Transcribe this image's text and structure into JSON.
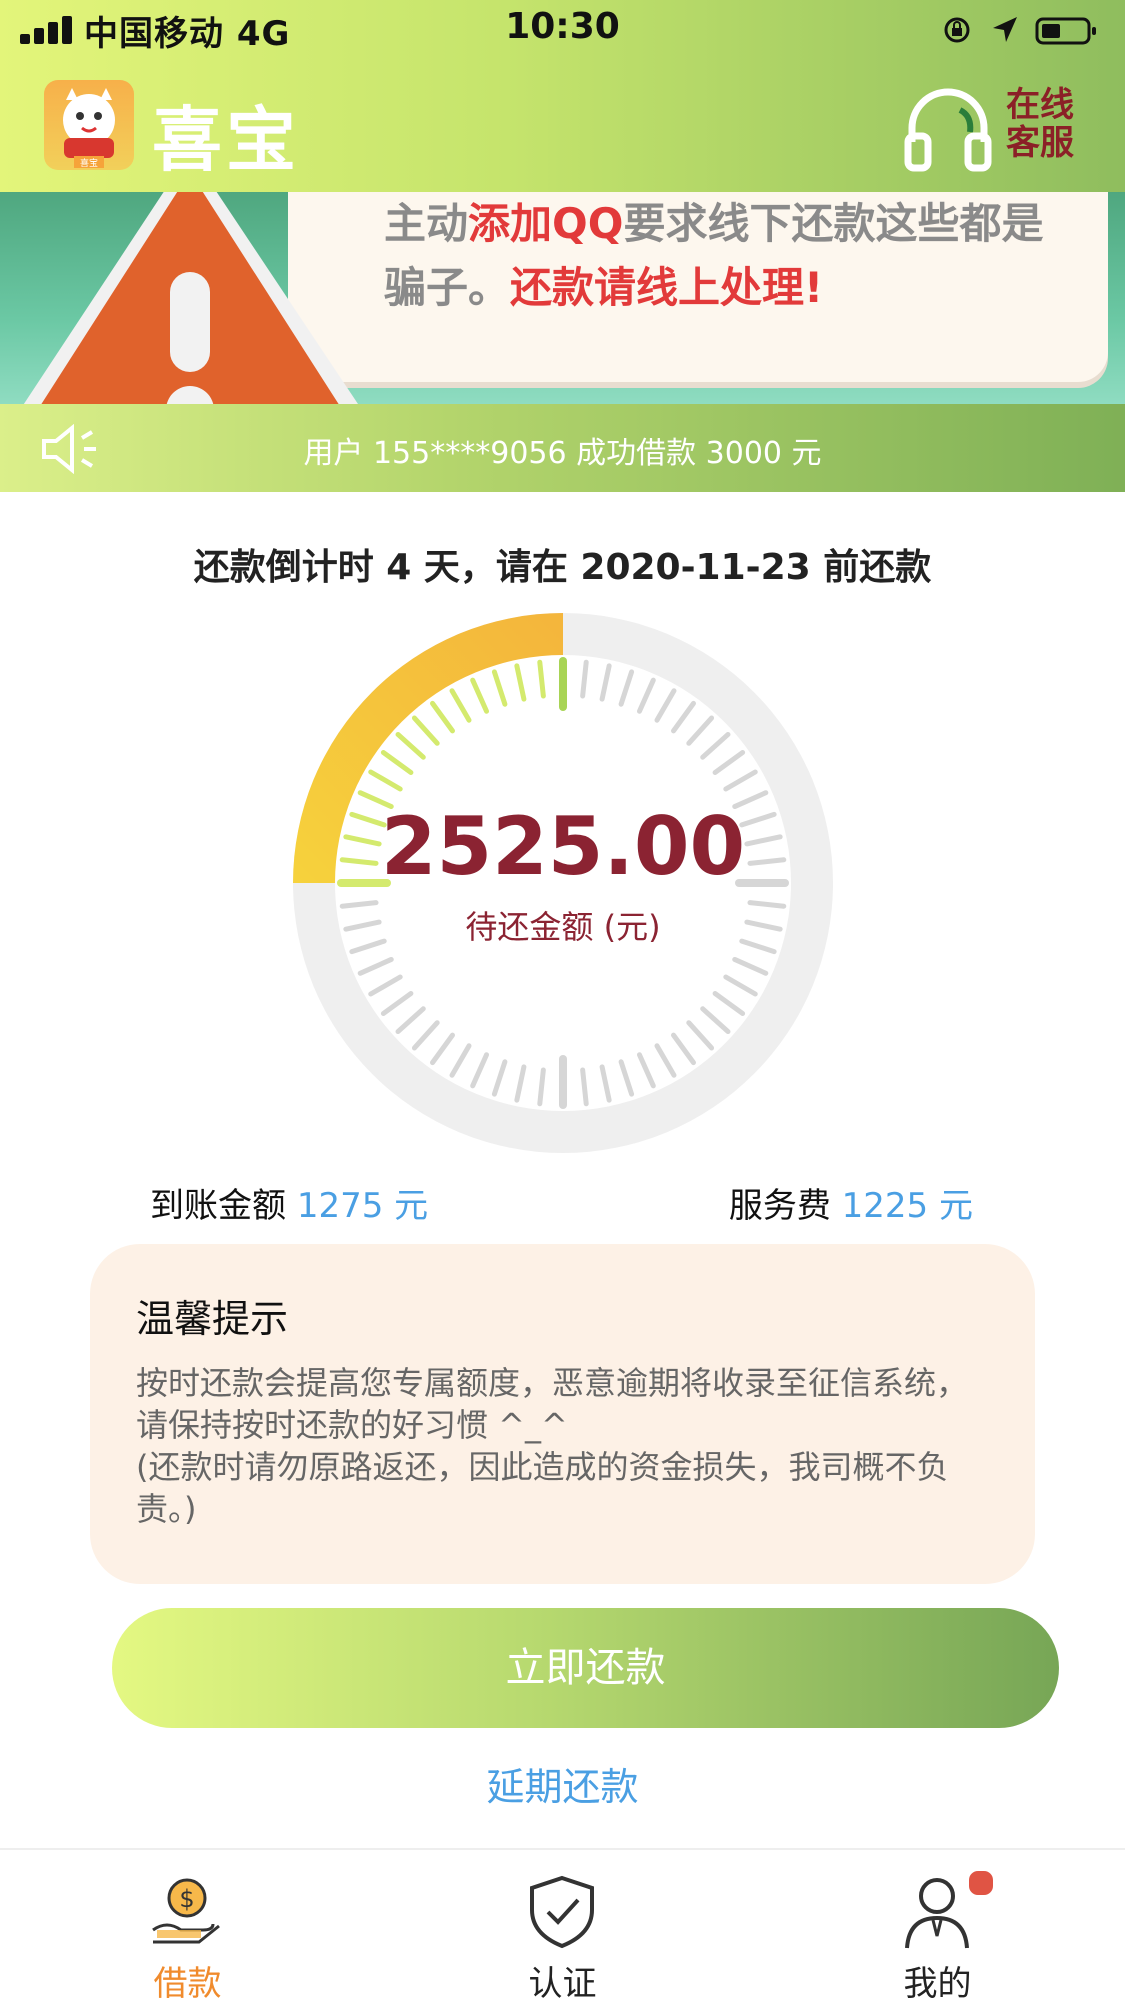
{
  "status_bar": {
    "carrier": "中国移动  4G",
    "time": "10:30",
    "icons": [
      "signal-bars-icon",
      "orientation-lock-icon",
      "location-arrow-icon",
      "battery-icon"
    ]
  },
  "header": {
    "app_name": "喜宝",
    "logo_caption": "喜宝",
    "service_label_line1": "在线",
    "service_label_line2": "客服",
    "service_icon": "headset-icon"
  },
  "banner": {
    "text_part1": "主动",
    "text_red1": "添加QQ",
    "text_part2": "要求线下还款这些都是骗子。",
    "text_red2": "还款请线上处理!",
    "icon": "warning-triangle-icon"
  },
  "notice": {
    "icon": "speaker-icon",
    "text": "用户 155****9056 成功借款 3000 元"
  },
  "repayment": {
    "countdown": "还款倒计时 4 天，请在 2020-11-23 前还款",
    "amount_due": "2525.00",
    "amount_label": "待还金额 (元)",
    "progress_fraction": 0.25,
    "received_label": "到账金额",
    "received_value": "1275 元",
    "fee_label": "服务费",
    "fee_value": "1225 元"
  },
  "tips": {
    "title": "温馨提示",
    "body": "按时还款会提高您专属额度，恶意逾期将收录至征信系统，请保持按时还款的好习惯 ^_^\n(还款时请勿原路返还，因此造成的资金损失，我司概不负责。)"
  },
  "actions": {
    "pay_now": "立即还款",
    "extend": "延期还款"
  },
  "tabbar": {
    "items": [
      {
        "label": "借款",
        "icon": "loan-hand-coin-icon",
        "active": true
      },
      {
        "label": "认证",
        "icon": "shield-check-icon",
        "active": false
      },
      {
        "label": "我的",
        "icon": "user-profile-icon",
        "active": false
      }
    ]
  },
  "colors": {
    "accent_green": "#8fbd5e",
    "amount_red": "#8b2332",
    "link_blue": "#4a9fe3",
    "active_tab_orange": "#f08b2d"
  }
}
